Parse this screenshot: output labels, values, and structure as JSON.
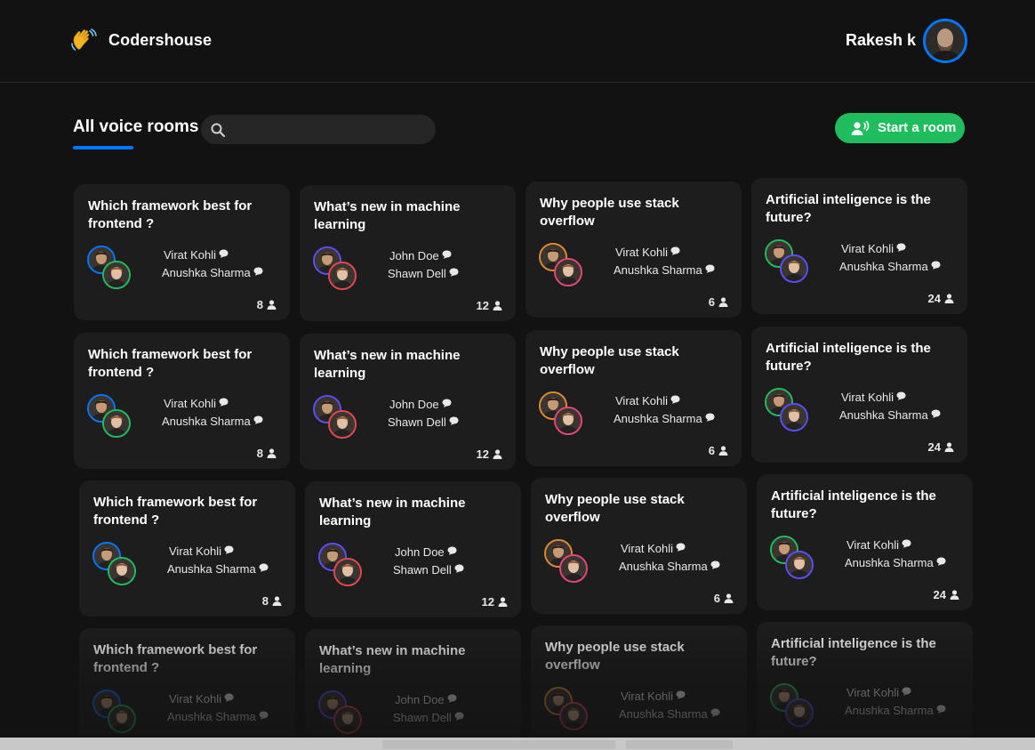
{
  "app": {
    "title": "Codershouse",
    "logo_icon": "waving-hand-icon"
  },
  "user": {
    "name": "Rakesh k",
    "avatar_border": "#0077ff"
  },
  "toolbar": {
    "section_title": "All voice rooms",
    "search_placeholder": "",
    "start_room_label": "Start a room"
  },
  "colors": {
    "accent": "#0077ff",
    "green": "#20bd5f",
    "card_bg": "#1d1d1d",
    "page_bg": "#121212"
  },
  "rooms": [
    {
      "title": "Which framework best for frontend ?",
      "speakers": [
        "Virat Kohli",
        "Anushka Sharma"
      ],
      "count": "8",
      "ring1": "#0077ff",
      "ring2": "#20bd5f"
    },
    {
      "title": "What’s new in machine learning",
      "speakers": [
        "John Doe",
        "Shawn  Dell"
      ],
      "count": "12",
      "ring1": "#5c4dff",
      "ring2": "#e5484d"
    },
    {
      "title": "Why people use stack overflow",
      "speakers": [
        "Virat Kohli",
        "Anushka Sharma"
      ],
      "count": "6",
      "ring1": "#e08a2f",
      "ring2": "#e8457a"
    },
    {
      "title": "Artificial inteligence is the future?",
      "speakers": [
        "Virat Kohli",
        "Anushka Sharma"
      ],
      "count": "24",
      "ring1": "#20bd5f",
      "ring2": "#5c4dff"
    }
  ]
}
